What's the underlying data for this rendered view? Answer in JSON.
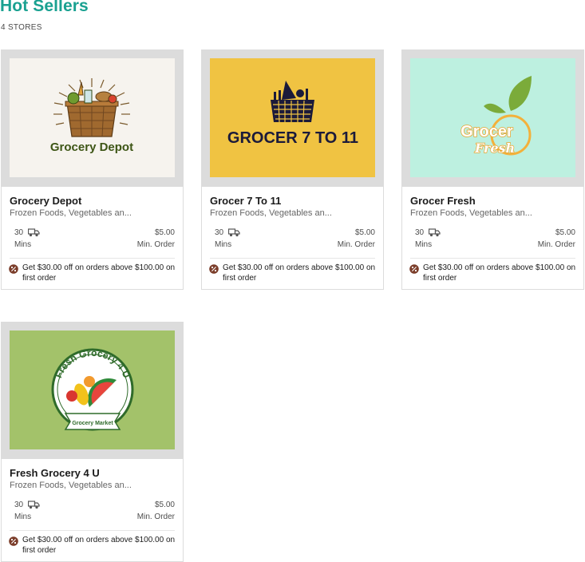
{
  "header": {
    "title": "Hot Sellers",
    "count": "4 STORES"
  },
  "stores": [
    {
      "name": "Grocery Depot",
      "categories": "Frozen Foods, Vegetables an...",
      "time": "30",
      "time_unit": "Mins",
      "min_order_value": "$5.00",
      "min_order_label": "Min. Order",
      "offer": "Get $30.00 off on orders above $100.00 on first order",
      "logo_text": "Grocery Depot"
    },
    {
      "name": "Grocer 7 To 11",
      "categories": "Frozen Foods, Vegetables an...",
      "time": "30",
      "time_unit": "Mins",
      "min_order_value": "$5.00",
      "min_order_label": "Min. Order",
      "offer": "Get $30.00 off on orders above $100.00 on first order",
      "logo_text": "GROCER 7 TO 11"
    },
    {
      "name": "Grocer Fresh",
      "categories": "Frozen Foods, Vegetables an...",
      "time": "30",
      "time_unit": "Mins",
      "min_order_value": "$5.00",
      "min_order_label": "Min. Order",
      "offer": "Get $30.00 off on orders above $100.00 on first order",
      "logo_text": [
        "Grocer",
        "Fresh"
      ]
    },
    {
      "name": "Fresh Grocery 4 U",
      "categories": "Frozen Foods, Vegetables an...",
      "time": "30",
      "time_unit": "Mins",
      "min_order_value": "$5.00",
      "min_order_label": "Min. Order",
      "offer": "Get $30.00 off on orders above $100.00 on first order",
      "logo_text": [
        "Fresh Grocery 4 U",
        "Grocery Market"
      ]
    }
  ]
}
